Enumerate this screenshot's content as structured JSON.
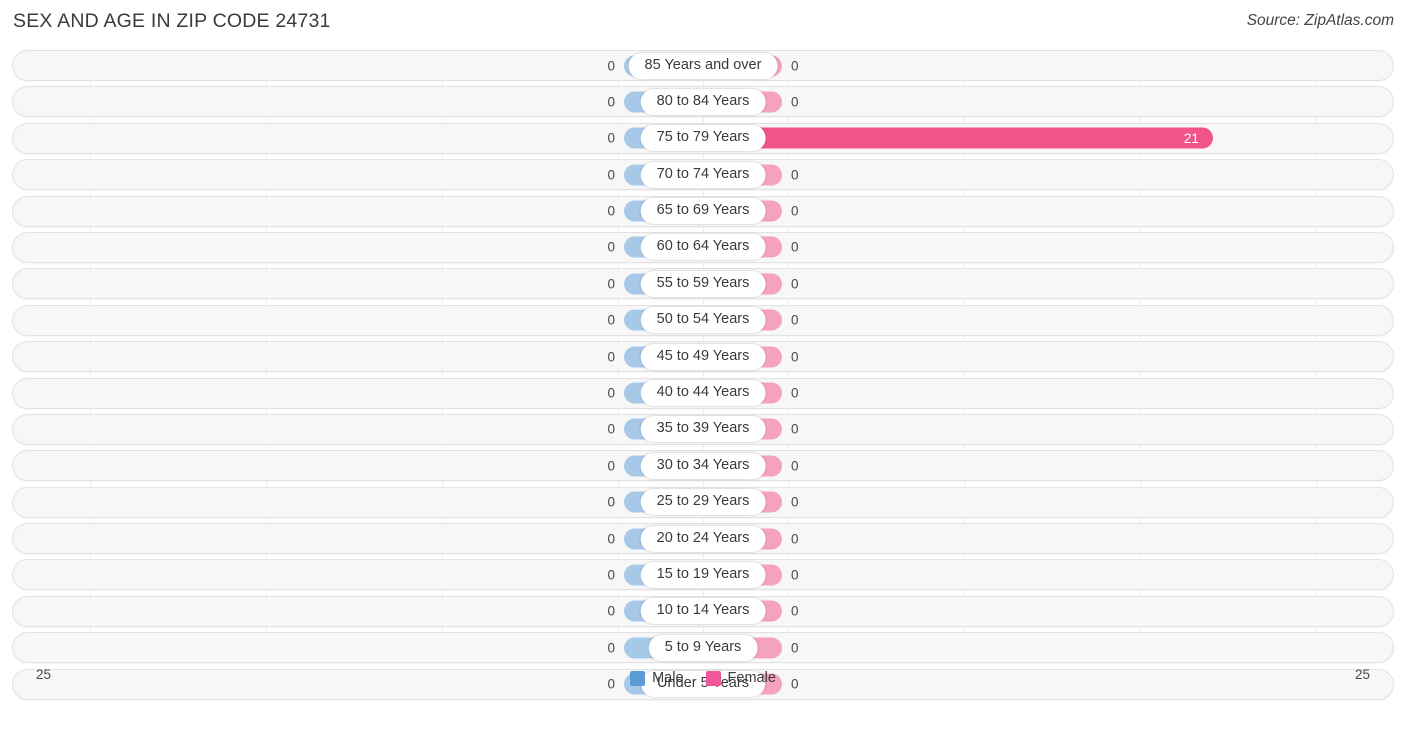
{
  "header": {
    "title": "SEX AND AGE IN ZIP CODE 24731",
    "source": "Source: ZipAtlas.com"
  },
  "legend": {
    "items": [
      {
        "label": "Male",
        "color": "#5b9bd5"
      },
      {
        "label": "Female",
        "color": "#f2569a"
      }
    ]
  },
  "axis": {
    "left_max": "25",
    "right_max": "25"
  },
  "colors": {
    "male_bar": "#a8c8e8",
    "female_bar": "#f5a3bc",
    "female_bar_active": "#f0548a",
    "row_background": "#f7f7f7",
    "row_border": "#e2e2e2"
  },
  "chart_data": {
    "type": "bar",
    "title": "SEX AND AGE IN ZIP CODE 24731",
    "subtitle": "",
    "xlabel": "",
    "ylabel": "",
    "orientation": "horizontal-diverging",
    "grid": true,
    "legend_position": "bottom-center",
    "axis_max": 25,
    "xlim": [
      25,
      25
    ],
    "categories": [
      "85 Years and over",
      "80 to 84 Years",
      "75 to 79 Years",
      "70 to 74 Years",
      "65 to 69 Years",
      "60 to 64 Years",
      "55 to 59 Years",
      "50 to 54 Years",
      "45 to 49 Years",
      "40 to 44 Years",
      "35 to 39 Years",
      "30 to 34 Years",
      "25 to 29 Years",
      "20 to 24 Years",
      "15 to 19 Years",
      "10 to 14 Years",
      "5 to 9 Years",
      "Under 5 Years"
    ],
    "series": [
      {
        "name": "Male",
        "values": [
          0,
          0,
          0,
          0,
          0,
          0,
          0,
          0,
          0,
          0,
          0,
          0,
          0,
          0,
          0,
          0,
          0,
          0
        ],
        "labels": [
          "0",
          "0",
          "0",
          "0",
          "0",
          "0",
          "0",
          "0",
          "0",
          "0",
          "0",
          "0",
          "0",
          "0",
          "0",
          "0",
          "0",
          "0"
        ]
      },
      {
        "name": "Female",
        "values": [
          0,
          0,
          21,
          0,
          0,
          0,
          0,
          0,
          0,
          0,
          0,
          0,
          0,
          0,
          0,
          0,
          0,
          0
        ],
        "labels": [
          "0",
          "0",
          "21",
          "0",
          "0",
          "0",
          "0",
          "0",
          "0",
          "0",
          "0",
          "0",
          "0",
          "0",
          "0",
          "0",
          "0",
          "0"
        ]
      }
    ]
  }
}
